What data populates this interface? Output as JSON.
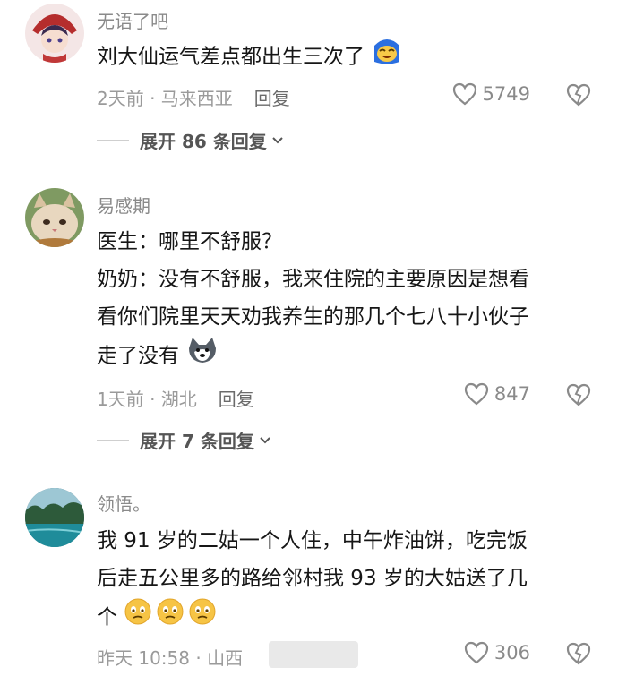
{
  "comments": [
    {
      "username": "无语了吧",
      "lines": [
        "刘大仙运气差点都出生三次了"
      ],
      "meta": "2天前 · 马来西亚",
      "reply": "回复",
      "likes": "5749",
      "expand": "展开 86 条回复"
    },
    {
      "username": "易感期",
      "lines": [
        "医生：哪里不舒服？",
        "奶奶：没有不舒服，我来住院的主要原因是想看",
        "看你们院里天天劝我养生的那几个七八十小伙子",
        "走了没有"
      ],
      "meta": "1天前 · 湖北",
      "reply": "回复",
      "likes": "847",
      "expand": "展开 7 条回复"
    },
    {
      "username": "领悟。",
      "lines": [
        "我 91 岁的二姑一个人住，中午炸油饼，吃完饭",
        "后走五公里多的路给邻村我 93 岁的大姑送了几",
        "个"
      ],
      "meta": "昨天 10:58 · 山西",
      "likes": "306"
    }
  ],
  "icons": {
    "like": "heart-outline-icon",
    "dislike": "broken-heart-icon",
    "expand": "chevron-down-icon"
  }
}
